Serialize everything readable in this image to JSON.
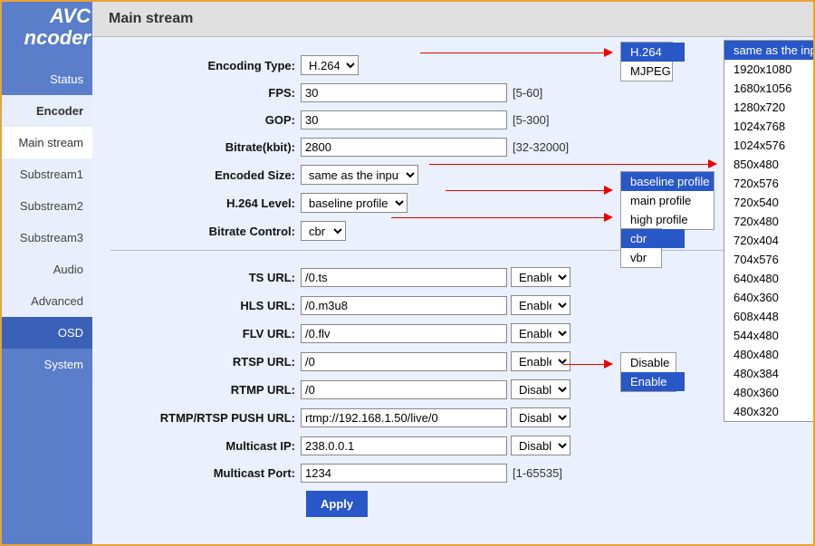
{
  "logo": {
    "line1": "AVC",
    "line2": "ncoder"
  },
  "nav": {
    "status": "Status",
    "encoder": "Encoder",
    "main_stream": "Main stream",
    "substream1": "Substream1",
    "substream2": "Substream2",
    "substream3": "Substream3",
    "audio": "Audio",
    "advanced": "Advanced",
    "osd": "OSD",
    "system": "System"
  },
  "page_title": "Main stream",
  "labels": {
    "encoding_type": "Encoding Type:",
    "fps": "FPS:",
    "gop": "GOP:",
    "bitrate_kbit": "Bitrate(kbit):",
    "encoded_size": "Encoded Size:",
    "h264_level": "H.264 Level:",
    "bitrate_control": "Bitrate Control:",
    "ts_url": "TS URL:",
    "hls_url": "HLS URL:",
    "flv_url": "FLV URL:",
    "rtsp_url": "RTSP URL:",
    "rtmp_url": "RTMP URL:",
    "push_url": "RTMP/RTSP PUSH URL:",
    "multicast_ip": "Multicast IP:",
    "multicast_port": "Multicast Port:"
  },
  "values": {
    "encoding_type": "H.264",
    "fps": "30",
    "gop": "30",
    "bitrate_kbit": "2800",
    "encoded_size": "same as the input",
    "h264_level": "baseline profile",
    "bitrate_control": "cbr",
    "ts_url": "/0.ts",
    "hls_url": "/0.m3u8",
    "flv_url": "/0.flv",
    "rtsp_url": "/0",
    "rtmp_url": "/0",
    "push_url": "rtmp://192.168.1.50/live/0",
    "multicast_ip": "238.0.0.1",
    "multicast_port": "1234",
    "ts_enable": "Enable",
    "hls_enable": "Enable",
    "flv_enable": "Enable",
    "rtsp_enable": "Enable",
    "rtmp_enable": "Disable",
    "push_enable": "Disable",
    "multicast_enable": "Disable"
  },
  "hints": {
    "fps": "[5-60]",
    "gop": "[5-300]",
    "bitrate": "[32-32000]",
    "multicast_port": "[1-65535]"
  },
  "apply": "Apply",
  "popups": {
    "encoding_type": [
      "H.264",
      "MJPEG"
    ],
    "encoding_type_selected": 0,
    "h264_level": [
      "baseline profile",
      "main profile",
      "high profile"
    ],
    "h264_level_selected": 0,
    "bitrate_control": [
      "cbr",
      "vbr"
    ],
    "bitrate_control_selected": 0,
    "rtsp_enable": [
      "Disable",
      "Enable"
    ],
    "rtsp_enable_selected": 1,
    "sizes": [
      "same as the input",
      "1920x1080",
      "1680x1056",
      "1280x720",
      "1024x768",
      "1024x576",
      "850x480",
      "720x576",
      "720x540",
      "720x480",
      "720x404",
      "704x576",
      "640x480",
      "640x360",
      "608x448",
      "544x480",
      "480x480",
      "480x384",
      "480x360",
      "480x320"
    ],
    "sizes_selected": 0
  }
}
